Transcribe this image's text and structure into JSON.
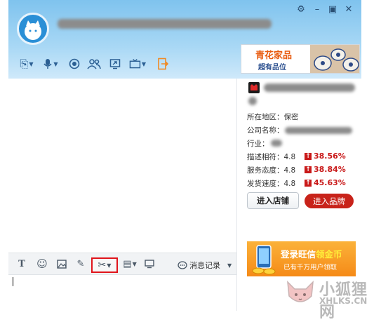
{
  "colors": {
    "header_gradient": "#7fc3ee",
    "accent_red": "#c91919",
    "brand_button": "#c8231a",
    "promo_orange": "#f58a17",
    "highlight_box": "#e0141b"
  },
  "window_controls": [
    {
      "icon": "settings-gear",
      "glyph": "⚙"
    },
    {
      "icon": "minimize",
      "glyph": "–"
    },
    {
      "icon": "maximize",
      "glyph": "▣"
    },
    {
      "icon": "close",
      "glyph": "✕"
    }
  ],
  "header_toolbar": [
    {
      "icon": "file-transfer",
      "glyph": "⎘"
    },
    {
      "icon": "microphone",
      "glyph": "🎙"
    },
    {
      "icon": "video",
      "glyph": "◉"
    },
    {
      "icon": "contacts",
      "glyph": "👥"
    },
    {
      "icon": "screen-share",
      "glyph": "⧉"
    },
    {
      "icon": "remote-assist",
      "glyph": "📺"
    },
    {
      "icon": "share",
      "glyph": "⇥"
    }
  ],
  "ad_banner": {
    "title": "青花家品",
    "subtitle": "超有品位"
  },
  "shop_info": {
    "region_label": "所在地区：保密",
    "company_label": "公司名称：",
    "industry_label": "行业：",
    "ratings": [
      {
        "label": "描述相符：4.8",
        "percent": "38.56%"
      },
      {
        "label": "服务态度：4.8",
        "percent": "38.84%"
      },
      {
        "label": "发货速度：4.8",
        "percent": "45.63%"
      }
    ],
    "enter_shop": "进入店铺",
    "enter_brand": "进入品牌"
  },
  "chat_toolbar": {
    "icons": [
      {
        "icon": "font",
        "glyph": "T"
      },
      {
        "icon": "emoji",
        "glyph": "☺"
      },
      {
        "icon": "image",
        "glyph": "▧"
      },
      {
        "icon": "edit",
        "glyph": "✎"
      }
    ],
    "scissors_glyph": "✂",
    "extra_icons": [
      {
        "icon": "table",
        "glyph": "▤"
      },
      {
        "icon": "monitor",
        "glyph": "▭"
      }
    ],
    "history_label": "消息记录",
    "history_glyph": "💬"
  },
  "promo": {
    "title_prefix": "登录旺信",
    "title_highlight": "领金币",
    "subtitle": "已有千万用户领取"
  },
  "watermark": {
    "text": "小狐狸网",
    "sub": "XHLKS.CN"
  }
}
